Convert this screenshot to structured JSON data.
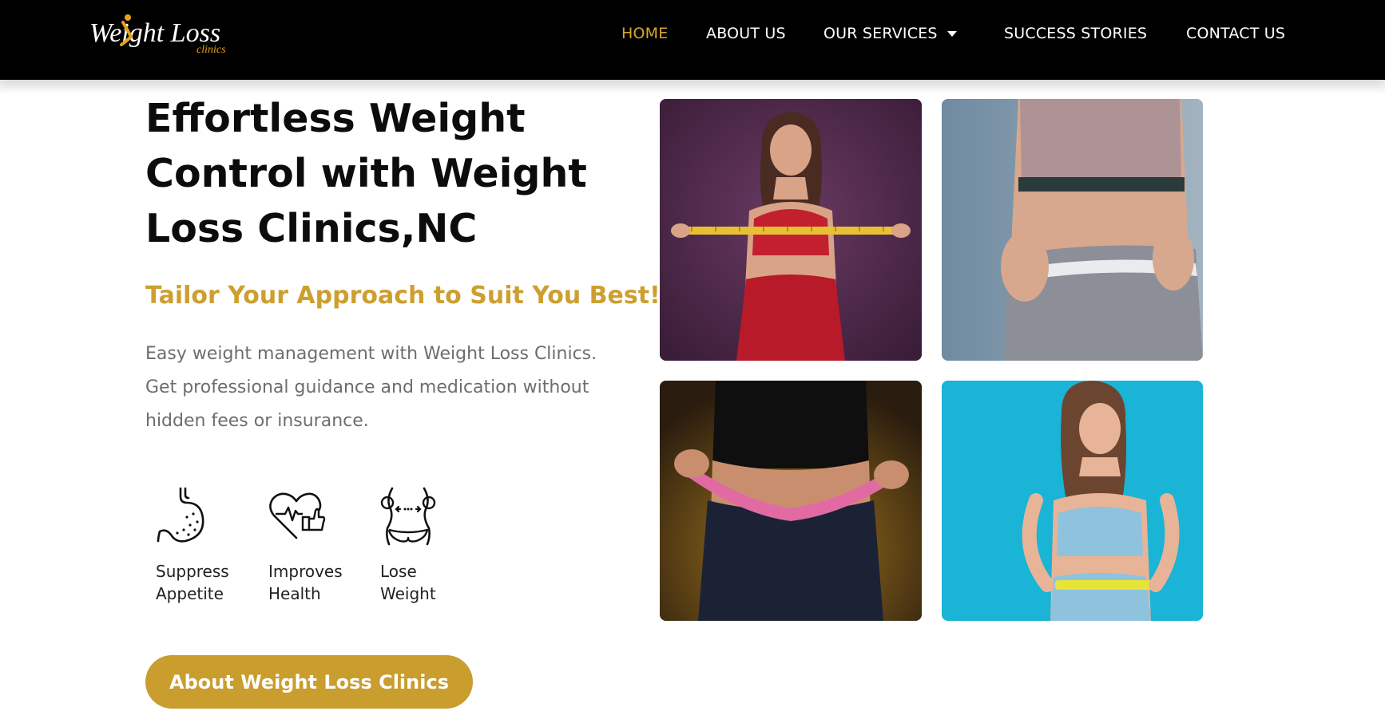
{
  "header": {
    "logo": {
      "word": "Weight Loss",
      "sub": "clinics",
      "icon": "person-icon",
      "accent": "#e6a21a"
    },
    "nav": [
      {
        "label": "HOME",
        "active": true
      },
      {
        "label": "ABOUT US",
        "active": false
      },
      {
        "label": "OUR SERVICES",
        "active": false,
        "has_dropdown": true,
        "icon": "caret-down-icon"
      },
      {
        "label": "SUCCESS STORIES",
        "active": false
      },
      {
        "label": "CONTACT US",
        "active": false
      }
    ]
  },
  "hero": {
    "title": "Effortless Weight Control with Weight Loss Clinics,NC",
    "subtitle": "Tailor Your Approach to Suit You Best!",
    "description": "Easy weight management with Weight Loss Clinics. Get professional guidance and medication without hidden fees or insurance.",
    "features": [
      {
        "icon": "stomach-icon",
        "line1": "Suppress",
        "line2": "Appetite"
      },
      {
        "icon": "heart-health-icon",
        "line1": "Improves",
        "line2": "Health"
      },
      {
        "icon": "waist-slimming-icon",
        "line1": "Lose",
        "line2": "Weight"
      }
    ],
    "cta_label": "About Weight Loss Clinics"
  },
  "gallery": [
    {
      "name": "woman-measuring-tape-purple-photo"
    },
    {
      "name": "waist-measuring-tape-closeup-photo"
    },
    {
      "name": "waist-pink-tape-jeans-photo"
    },
    {
      "name": "woman-yellow-tape-blue-photo"
    }
  ],
  "colors": {
    "header_bg": "#000000",
    "nav_text": "#ffffff",
    "nav_active": "#d9a62a",
    "accent": "#c99d2e",
    "title_text": "#0c0c0c",
    "body_text": "#6d6d6d"
  }
}
